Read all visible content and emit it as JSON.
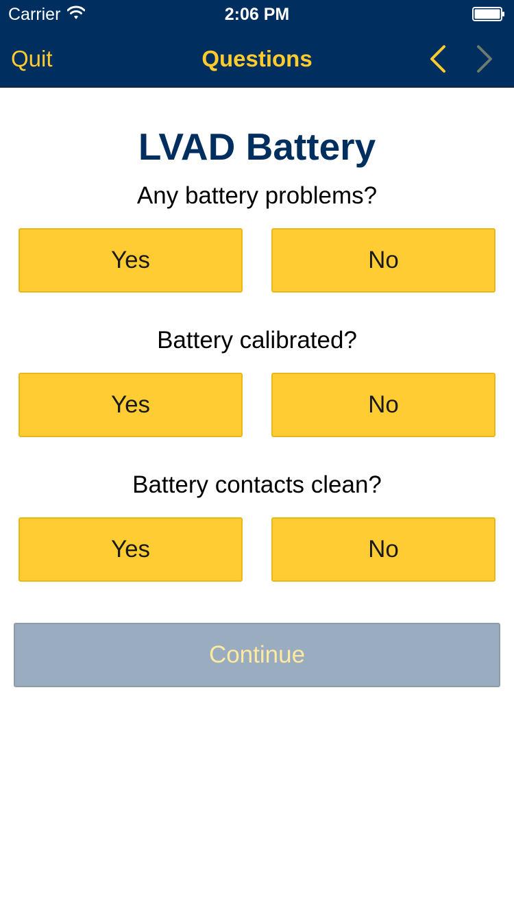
{
  "status_bar": {
    "carrier": "Carrier",
    "time": "2:06 PM",
    "wifi_icon": "wifi-icon",
    "battery_icon": "battery-icon"
  },
  "nav": {
    "quit_label": "Quit",
    "title": "Questions",
    "back_icon": "chevron-left-icon",
    "forward_icon": "chevron-right-icon",
    "forward_enabled": false
  },
  "page": {
    "title": "LVAD Battery"
  },
  "questions": [
    {
      "text": "Any battery problems?",
      "yes_label": "Yes",
      "no_label": "No"
    },
    {
      "text": "Battery calibrated?",
      "yes_label": "Yes",
      "no_label": "No"
    },
    {
      "text": "Battery contacts clean?",
      "yes_label": "Yes",
      "no_label": "No"
    }
  ],
  "continue": {
    "label": "Continue",
    "enabled": false
  },
  "colors": {
    "nav_background": "#002f5f",
    "accent_yellow": "#ffcb2e",
    "button_yellow": "#ffcd33",
    "title_navy": "#002f5f",
    "disabled_button": "#9aacc0"
  }
}
